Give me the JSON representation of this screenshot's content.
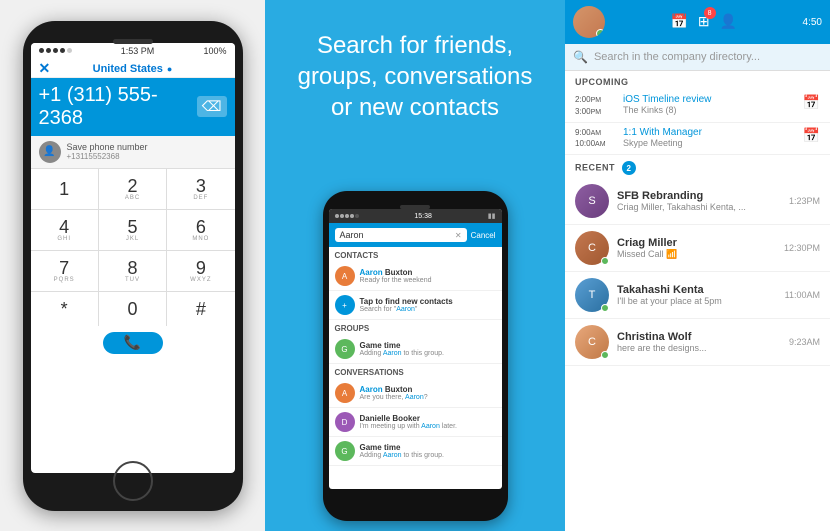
{
  "phone1": {
    "status_dots": 5,
    "time": "1:53 PM",
    "battery": "100%",
    "wifi": "wifi",
    "country": "United States",
    "country_flag": "●",
    "phone_number": "+1 (311) 555-2368",
    "backspace": "⌫",
    "x_btn": "✕",
    "save_label": "Save phone number",
    "save_number": "+13115552368",
    "keys": [
      {
        "main": "1",
        "sub": ""
      },
      {
        "main": "2",
        "sub": "abc"
      },
      {
        "main": "3",
        "sub": "def"
      },
      {
        "main": "4",
        "sub": "ghi"
      },
      {
        "main": "5",
        "sub": "jkl"
      },
      {
        "main": "6",
        "sub": "mno"
      },
      {
        "main": "7",
        "sub": "pqrs"
      },
      {
        "main": "8",
        "sub": "tuv"
      },
      {
        "main": "9",
        "sub": "wxyz"
      },
      {
        "main": "*",
        "sub": ""
      },
      {
        "main": "0",
        "sub": ""
      },
      {
        "main": "#",
        "sub": ""
      }
    ]
  },
  "middle": {
    "headline": "Search for friends, groups, conversations or new contacts",
    "status_time": "15:38",
    "search_placeholder": "Aaron",
    "cancel_label": "Cancel",
    "contacts_section": "Contacts",
    "groups_section": "Groups",
    "conversations_section": "Conversations",
    "contacts": [
      {
        "name": "Aaron Buxton",
        "sub": "Ready for the weekend",
        "highlight": "Aaron"
      },
      {
        "name": "Tap to find new contacts",
        "sub": "Search for \"Aaron\"",
        "highlight": ""
      }
    ],
    "groups": [
      {
        "name": "Game time",
        "sub": "Adding Aaron to this group.",
        "highlight": "Aaron"
      }
    ],
    "conversations": [
      {
        "name": "Aaron Buxton",
        "sub": "Are you there, Aaron?",
        "highlight": "Aaron"
      },
      {
        "name": "Danielle Booker",
        "sub": "I'm meeting up with Aaron later.",
        "highlight": "Aaron"
      },
      {
        "name": "Game time",
        "sub": "Adding Aaron to this group.",
        "highlight": "Aaron"
      }
    ]
  },
  "right": {
    "time": "4:50",
    "badge_count": "8",
    "search_placeholder": "Search in the company directory...",
    "upcoming_label": "UPCOMING",
    "recent_label": "RECENT",
    "recent_count": "2",
    "calendar_items": [
      {
        "start": "2:00PM",
        "end": "3:00PM",
        "title": "iOS Timeline review",
        "sub": "The Kinks (8)"
      },
      {
        "start": "9:00AM",
        "end": "10:00AM",
        "title": "1:1 With Manager",
        "sub": "Skype Meeting"
      }
    ],
    "chat_items": [
      {
        "name": "SFB Rebranding",
        "sub": "Criag Miller, Takahashi Kenta, ...",
        "time": "1:23PM",
        "status": ""
      },
      {
        "name": "Criag Miller",
        "sub": "Missed Call 📶",
        "time": "12:30PM",
        "status": "green"
      },
      {
        "name": "Takahashi Kenta",
        "sub": "I'll be at your place at 5pm",
        "time": "11:00AM",
        "status": "green"
      },
      {
        "name": "Christina Wolf",
        "sub": "here are the designs...",
        "time": "9:23AM",
        "status": "green"
      }
    ]
  }
}
